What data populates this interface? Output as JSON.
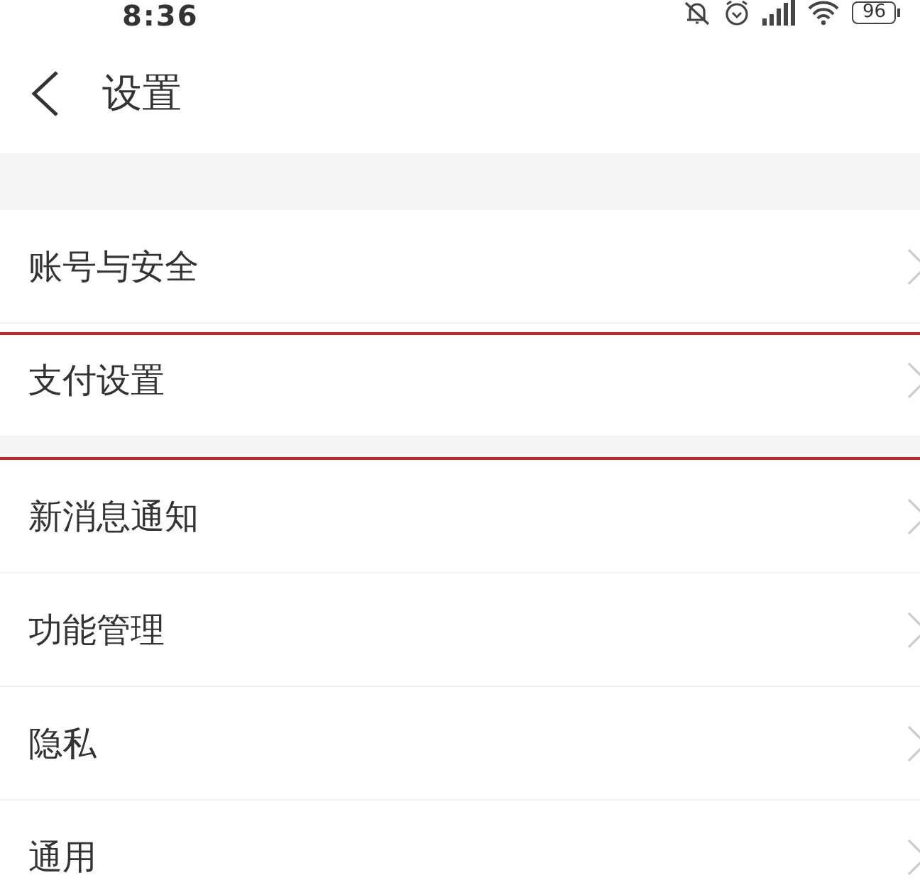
{
  "status_bar": {
    "time": "8:36",
    "battery": "96"
  },
  "header": {
    "title": "设置"
  },
  "groups": [
    {
      "items": [
        {
          "label": "账号与安全",
          "highlighted": false
        },
        {
          "label": "支付设置",
          "highlighted": true
        }
      ]
    },
    {
      "items": [
        {
          "label": "新消息通知",
          "highlighted": false
        },
        {
          "label": "功能管理",
          "highlighted": false
        },
        {
          "label": "隐私",
          "highlighted": false
        },
        {
          "label": "通用",
          "highlighted": false
        }
      ]
    }
  ]
}
